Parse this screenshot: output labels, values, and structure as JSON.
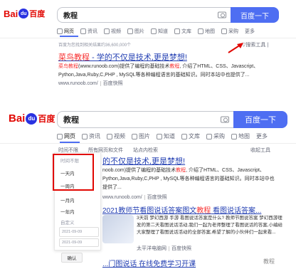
{
  "panel1": {
    "logo": {
      "bai": "Bai",
      "du": "du",
      "cn": "百度"
    },
    "query": "教程",
    "search_button": "百度一下",
    "tabs": [
      "网页",
      "资讯",
      "视频",
      "图片",
      "知道",
      "文库",
      "地图",
      "采购",
      "更多"
    ],
    "stats": "百度为您找到相关结果约36,600,000个",
    "search_tools": "搜索工具",
    "result": {
      "title_hl": "菜鸟教程",
      "title_rest": " - 学的不仅是技术,更是梦想!",
      "snippet_a": "菜鸟",
      "snippet_hl": "教程",
      "snippet_b": "(www.runoob.com)提供了编程的基础技术",
      "snippet_hl2": "教程",
      "snippet_c": ", 介绍了HTML、CSS、Javascript、Python,Java,Ruby,C,PHP , MySQL等各种编程语言的基础知识。同时本站中也提供了...",
      "url": "www.runoob.com/",
      "cache": "百度快照"
    }
  },
  "panel2": {
    "logo": {
      "bai": "Bai",
      "du": "du",
      "cn": "百度"
    },
    "query": "教程",
    "search_button": "百度一下",
    "tabs": [
      "网页",
      "资讯",
      "视频",
      "图片",
      "知道",
      "文库",
      "采购",
      "地图",
      "更多"
    ],
    "tools": [
      "时间不限",
      "所有网页和文件",
      "站点内检索"
    ],
    "collapse_tools": "收起工具",
    "dropdown": {
      "header": "时间不限",
      "items": [
        "一天内",
        "一周内",
        "一月内",
        "一年内"
      ],
      "custom_label": "自定义",
      "date_from": "2021-09-09",
      "date_to": "2021-09-09",
      "confirm": "确认"
    },
    "result1": {
      "title": "的不仅是技术,更是梦想!",
      "snippet_a": "noob.com)提供了编程的基础技术",
      "snippet_hl": "教程",
      "snippet_b": ", 介绍了HTML、CSS、Javascript、Python,Java,Ruby,C,PHP , MySQL等各种编程语言的基础知识。同时本站中也提供了...",
      "url": "www.runoob.com/",
      "cache": "百度快照"
    },
    "result2": {
      "title_a": "2021教师节看图说话答案图文",
      "title_hl": "教程",
      "title_b": " 看图说话答案...",
      "snippet": "3天前 梦幻西游 手游 看图说话答案是什么? 教师节图说答案 梦幻西游理发的第二天看图说话活动,我们一起为老师整理了看图说话的答案,小编给大家整理了看图说话活动的全部答案,希望了解的小伙伴们一起来看...",
      "source": "太平洋电脑网",
      "cache": "百度快照"
    },
    "result3_partial": "...门图说话 在线免费学习开课",
    "watermark": "教程"
  }
}
